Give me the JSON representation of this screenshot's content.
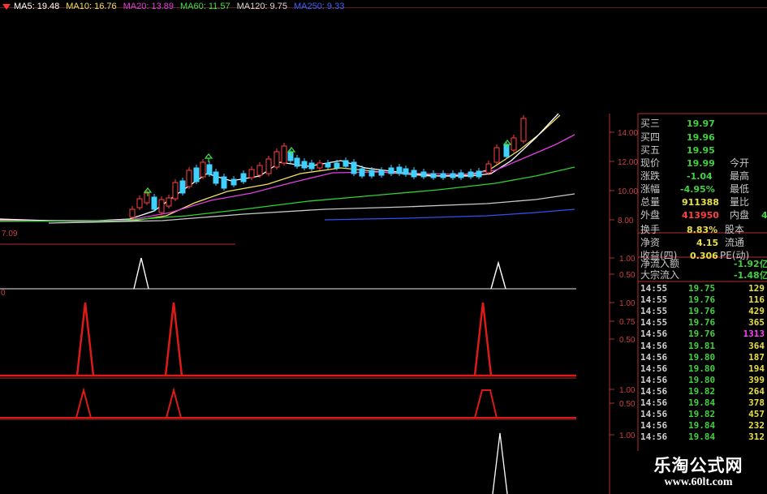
{
  "ma_legend": [
    {
      "label": "MA5: 19.48",
      "color": "#ffffff"
    },
    {
      "label": "MA10: 16.76",
      "color": "#f0e060"
    },
    {
      "label": "MA20: 13.89",
      "color": "#e040e0"
    },
    {
      "label": "MA60: 11.57",
      "color": "#40e040"
    },
    {
      "label": "MA120: 9.75",
      "color": "#d8d8d8"
    },
    {
      "label": "MA250: 9.33",
      "color": "#4060ff"
    }
  ],
  "price_axis": [
    "14.00",
    "12.00",
    "10.00",
    "8.00"
  ],
  "low_label": "7.09",
  "sub1_axis": [
    "1.00",
    "0.50"
  ],
  "sub2_axis": [
    "1.00",
    "0.75",
    "0.50"
  ],
  "sub3_axis": [
    "1.00",
    "0.50"
  ],
  "sub4_axis": [
    "1.00"
  ],
  "quote": {
    "buy3_label": "买三",
    "buy3_value": "19.97",
    "buy4_label": "买四",
    "buy4_value": "19.96",
    "buy5_label": "买五",
    "buy5_value": "19.95",
    "price_label": "现价",
    "price_value": "19.99",
    "open_label": "今开",
    "change_label": "涨跌",
    "change_value": "-1.04",
    "high_label": "最高",
    "pct_label": "涨幅",
    "pct_value": "-4.95%",
    "low_label": "最低",
    "volume_label": "总量",
    "volume_value": "911388",
    "ratio_label": "量比",
    "outer_label": "外盘",
    "outer_value": "413950",
    "inner_label": "内盘",
    "inner_value": "4",
    "turnover_label": "换手",
    "turnover_value": "8.83%",
    "equity_label": "股本",
    "nav_label": "净资",
    "nav_value": "4.15",
    "float_label": "流通",
    "eps_label": "收益(四)",
    "eps_value": "0.306",
    "pe_label": "PE(动)",
    "netflow_label": "净流入额",
    "netflow_value": "-1.92亿",
    "bigflow_label": "大宗流入",
    "bigflow_value": "-1.48亿"
  },
  "ticks": [
    {
      "time": "14:55",
      "price": "19.75",
      "vol": "129",
      "vol_color": "#e8e040"
    },
    {
      "time": "14:55",
      "price": "19.76",
      "vol": "116",
      "vol_color": "#e8e040"
    },
    {
      "time": "14:55",
      "price": "19.76",
      "vol": "429",
      "vol_color": "#e8e040"
    },
    {
      "time": "14:55",
      "price": "19.76",
      "vol": "365",
      "vol_color": "#e8e040"
    },
    {
      "time": "14:56",
      "price": "19.76",
      "vol": "1313",
      "vol_color": "#ff40ff"
    },
    {
      "time": "14:56",
      "price": "19.81",
      "vol": "364",
      "vol_color": "#e8e040"
    },
    {
      "time": "14:56",
      "price": "19.80",
      "vol": "187",
      "vol_color": "#e8e040"
    },
    {
      "time": "14:56",
      "price": "19.80",
      "vol": "194",
      "vol_color": "#e8e040"
    },
    {
      "time": "14:56",
      "price": "19.80",
      "vol": "399",
      "vol_color": "#e8e040"
    },
    {
      "time": "14:56",
      "price": "19.82",
      "vol": "264",
      "vol_color": "#e8e040"
    },
    {
      "time": "14:56",
      "price": "19.84",
      "vol": "378",
      "vol_color": "#e8e040"
    },
    {
      "time": "14:56",
      "price": "19.82",
      "vol": "457",
      "vol_color": "#e8e040"
    },
    {
      "time": "14:56",
      "price": "19.84",
      "vol": "232",
      "vol_color": "#e8e040"
    },
    {
      "time": "14:56",
      "price": "19.84",
      "vol": "312",
      "vol_color": "#e8e040"
    }
  ],
  "watermark": {
    "title": "乐淘公式网",
    "url": "www.60lt.com"
  }
}
